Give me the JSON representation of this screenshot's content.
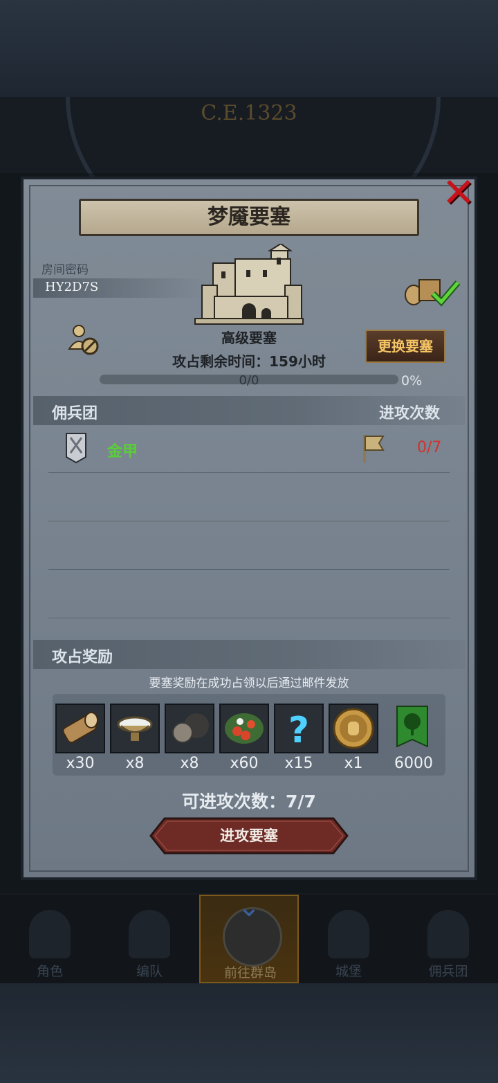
{
  "background": {
    "era_text": "C.E.1323"
  },
  "dialog": {
    "title": "梦魇要塞",
    "room_label": "房间密码",
    "room_code": "HY2D7S",
    "fortress_level": "高级要塞",
    "change_button": "更换要塞",
    "remaining_time": "攻占剩余时间：159小时",
    "progress": {
      "count_text": "0/0",
      "percent_text": "0%",
      "value": 0
    },
    "mercenary_section": {
      "title": "佣兵团",
      "attack_count_header": "进攻次数",
      "rows": [
        {
          "name": "金甲",
          "attacks": "0/7",
          "banner_icon": "white-shield-banner-icon",
          "flag_icon": "flag-icon"
        }
      ]
    },
    "reward_section": {
      "title": "攻占奖励",
      "note": "要塞奖励在成功占领以后通过邮件发放",
      "items": [
        {
          "icon": "wood-log-icon",
          "qty": "x30"
        },
        {
          "icon": "salt-bowl-icon",
          "qty": "x8"
        },
        {
          "icon": "ore-icon",
          "qty": "x8"
        },
        {
          "icon": "berries-icon",
          "qty": "x60"
        },
        {
          "icon": "mystery-question-icon",
          "qty": "x15"
        },
        {
          "icon": "knight-coin-icon",
          "qty": "x1"
        },
        {
          "icon": "guild-tree-banner-icon",
          "qty": "6000"
        }
      ]
    },
    "attackable_text": "可进攻次数：7/7",
    "attack_button": "进攻要塞"
  },
  "nav": {
    "items": [
      {
        "label": "角色",
        "icon": "knight-icon",
        "active": false
      },
      {
        "label": "编队",
        "icon": "helmet-icon",
        "active": false
      },
      {
        "label": "前往群岛",
        "icon": "compass-icon",
        "active": true
      },
      {
        "label": "城堡",
        "icon": "castle-icon",
        "active": false
      },
      {
        "label": "佣兵团",
        "icon": "mercenary-icon",
        "active": false
      }
    ]
  },
  "colors": {
    "close_red": "#c8121b",
    "merc_name_green": "#5acd3a",
    "attack_count_red": "#d0332d",
    "change_button_text": "#f5c565",
    "attack_button_bg": "#6e2b26"
  }
}
